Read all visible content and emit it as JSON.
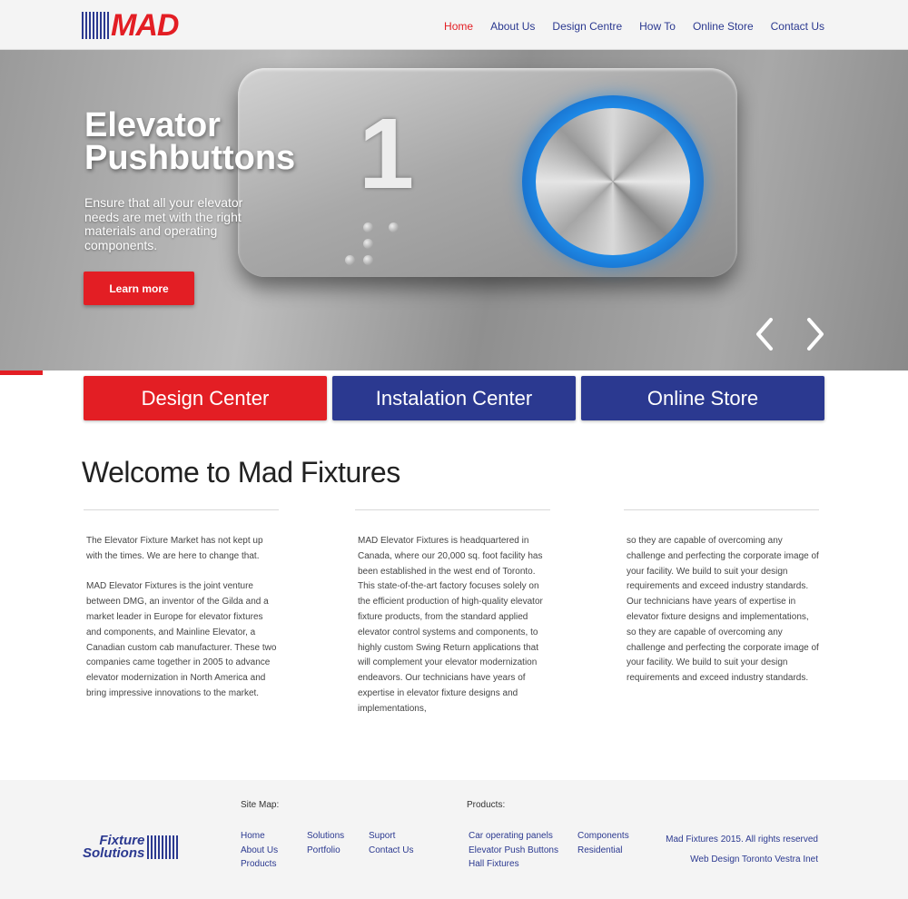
{
  "header": {
    "logo_text": "MAD",
    "nav": [
      {
        "label": "Home",
        "active": true
      },
      {
        "label": "About Us",
        "active": false
      },
      {
        "label": "Design Centre",
        "active": false
      },
      {
        "label": "How To",
        "active": false
      },
      {
        "label": "Online Store",
        "active": false
      },
      {
        "label": "Contact Us",
        "active": false
      }
    ]
  },
  "hero": {
    "title": "Elevator Pushbuttons",
    "text": "Ensure that all your elevator needs are met with the right materials and operating components.",
    "button_label": "Learn more",
    "numeral": "1"
  },
  "ctas": {
    "design": "Design Center",
    "install": "Instalation Center",
    "store": "Online Store"
  },
  "welcome": {
    "heading": "Welcome to Mad Fixtures",
    "col1_p1": "The Elevator Fixture Market has not kept up with the times.  We are here to change that.",
    "col1_p2": "MAD Elevator Fixtures is the joint venture between  DMG, an inventor of the Gilda and a market leader in Europe for elevator fixtures and components, and Mainline Elevator, a Canadian custom cab manufacturer. These two companies came together in 2005 to advance elevator modernization in North America and bring impressive innovations to the market.",
    "col2_p1": "MAD Elevator Fixtures is headquartered in Canada, where our 20,000 sq. foot facility has been established in the west end of Toronto. This state-of-the-art factory focuses solely on the efficient production of high-quality elevator fixture products, from the standard applied elevator control systems and components, to highly custom Swing Return applications that will complement your elevator modernization endeavors. Our technicians have years of expertise in elevator fixture designs and implementations,",
    "col3_p1": "so they are capable of overcoming any challenge and perfecting the corporate image of your facility. We build to suit your design requirements and exceed industry standards. Our technicians have years of expertise in elevator fixture designs and implementations, so they are capable of overcoming any challenge and perfecting the corporate image of your facility. We build to suit your design requirements and exceed industry standards."
  },
  "footer": {
    "logo_line1": "Fixture",
    "logo_line2": "Solutions",
    "sitemap_label": "Site Map:",
    "products_label": "Products:",
    "sitemap_col1": [
      "Home",
      "About Us",
      "Products"
    ],
    "sitemap_col2": [
      "Solutions",
      "Portfolio"
    ],
    "sitemap_col3": [
      "Suport",
      "Contact Us"
    ],
    "products_col1": [
      "Car operating panels",
      "Elevator Push Buttons",
      "Hall Fixtures"
    ],
    "products_col2": [
      "Components",
      "Residential"
    ],
    "copyright": "Mad Fixtures 2015. All rights reserved",
    "credit": "Web Design Toronto Vestra Inet"
  },
  "colors": {
    "brand_red": "#e31e24",
    "brand_blue": "#2b3990"
  },
  "icons": [
    "chevron-left-icon",
    "chevron-right-icon"
  ]
}
